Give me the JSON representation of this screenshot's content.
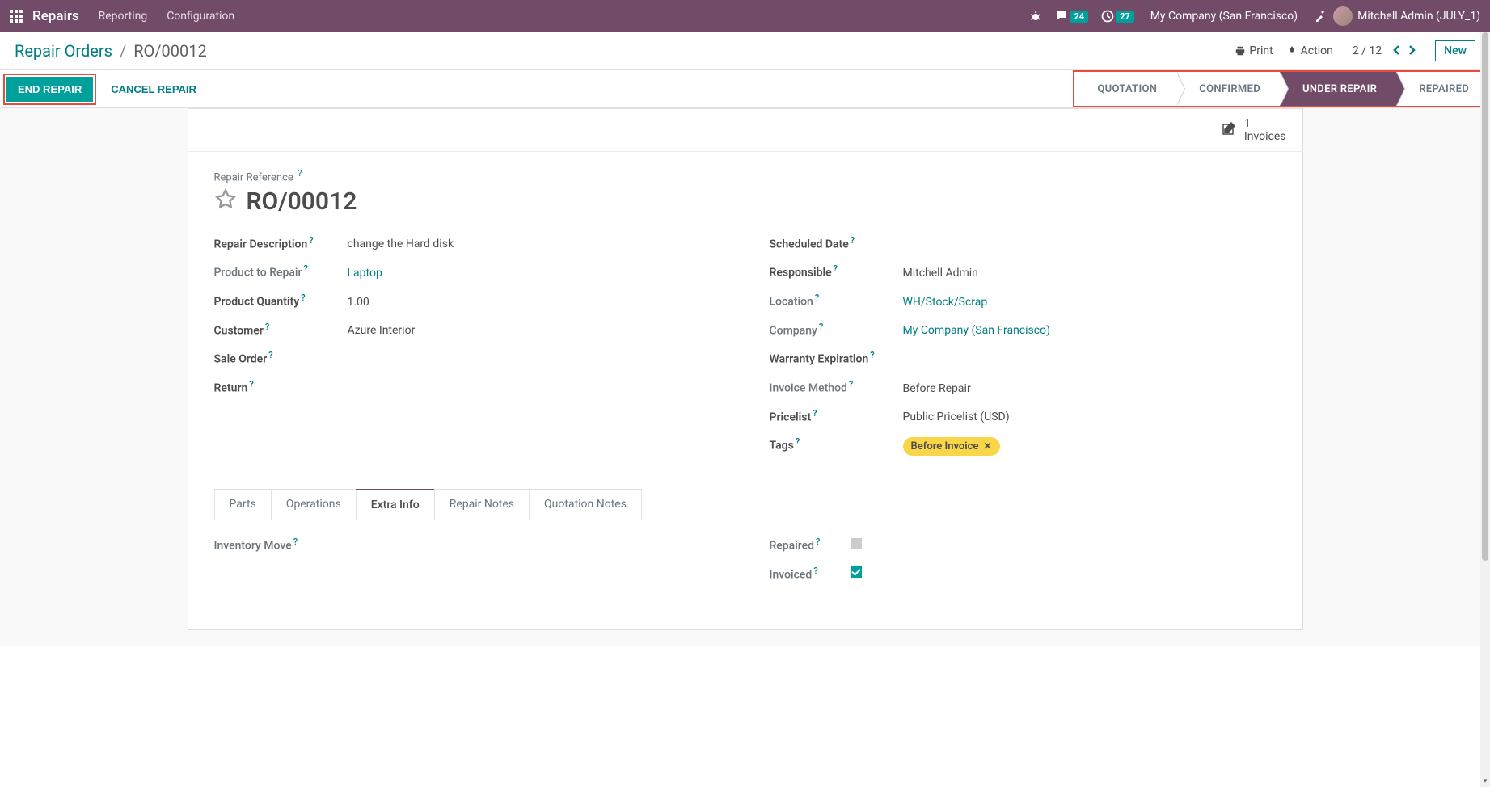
{
  "navbar": {
    "brand": "Repairs",
    "menu": [
      "Reporting",
      "Configuration"
    ],
    "messages_badge": "24",
    "activities_badge": "27",
    "company": "My Company (San Francisco)",
    "user": "Mitchell Admin (JULY_1)"
  },
  "breadcrumb": {
    "root": "Repair Orders",
    "current": "RO/00012"
  },
  "cp": {
    "print": "Print",
    "action": "Action",
    "pager": "2 / 12",
    "new": "New"
  },
  "buttons": {
    "end_repair": "End Repair",
    "cancel_repair": "Cancel Repair"
  },
  "status": {
    "quotation": "Quotation",
    "confirmed": "Confirmed",
    "under_repair": "Under Repair",
    "repaired": "Repaired"
  },
  "stat": {
    "invoices_count": "1",
    "invoices_label": "Invoices"
  },
  "title_label": "Repair Reference",
  "title": "RO/00012",
  "left": {
    "repair_description_label": "Repair Description",
    "repair_description": "change the Hard disk",
    "product_to_repair_label": "Product to Repair",
    "product_to_repair": "Laptop",
    "product_qty_label": "Product Quantity",
    "product_qty": "1.00",
    "customer_label": "Customer",
    "customer": "Azure Interior",
    "sale_order_label": "Sale Order",
    "sale_order": "",
    "return_label": "Return",
    "return": ""
  },
  "right": {
    "scheduled_date_label": "Scheduled Date",
    "scheduled_date": "",
    "responsible_label": "Responsible",
    "responsible": "Mitchell Admin",
    "location_label": "Location",
    "location": "WH/Stock/Scrap",
    "company_label": "Company",
    "company": "My Company (San Francisco)",
    "warranty_label": "Warranty Expiration",
    "warranty": "",
    "invoice_method_label": "Invoice Method",
    "invoice_method": "Before Repair",
    "pricelist_label": "Pricelist",
    "pricelist": "Public Pricelist (USD)",
    "tags_label": "Tags",
    "tag0": "Before Invoice"
  },
  "tabs": {
    "parts": "Parts",
    "operations": "Operations",
    "extra_info": "Extra Info",
    "repair_notes": "Repair Notes",
    "quotation_notes": "Quotation Notes"
  },
  "extra": {
    "inventory_move_label": "Inventory Move",
    "repaired_label": "Repaired",
    "invoiced_label": "Invoiced"
  }
}
